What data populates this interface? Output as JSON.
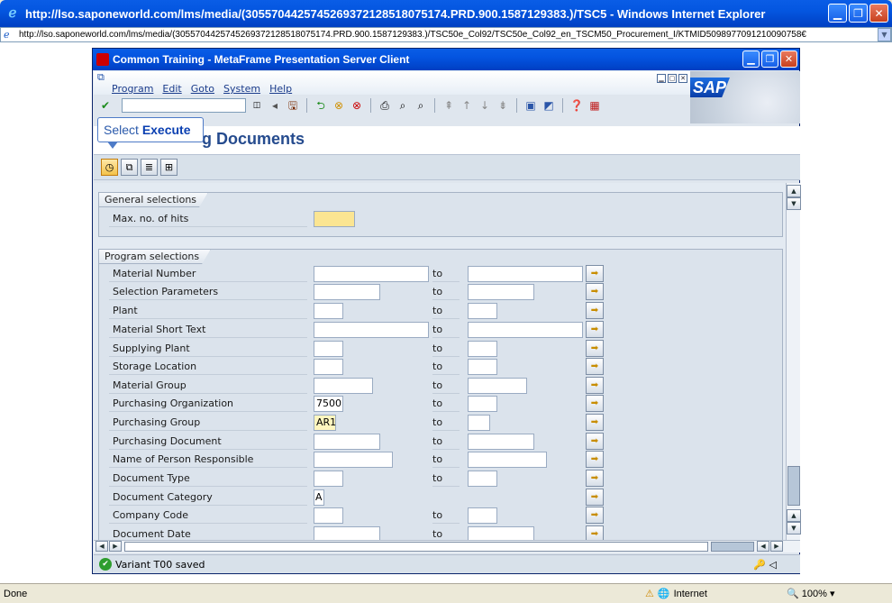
{
  "ie": {
    "title": "http://lso.saponeworld.com/lms/media/(3055704425745269372128518075174.PRD.900.1587129383.)/TSC5 - Windows Internet Explorer",
    "address": "http://lso.saponeworld.com/lms/media/(3055704425745269372128518075174.PRD.900.1587129383.)/TSC50e_Col92/TSC50e_Col92_en_TSCM50_Procurement_I/KTMID5098977091210090758€",
    "status_done": "Done",
    "zone_label": "Internet",
    "zoom": "100%"
  },
  "citrix": {
    "title": "Common Training - MetaFrame Presentation Server Client"
  },
  "sap": {
    "menu": [
      "Program",
      "Edit",
      "Goto",
      "System",
      "Help"
    ],
    "page_title": "g Documents",
    "tooltip_prefix": "Select ",
    "tooltip_bold": "Execute",
    "status_message": "Variant T00 saved",
    "groups": {
      "general": "General selections",
      "program": "Program selections"
    },
    "general_rows": [
      {
        "label": "Max. no. of hits",
        "value": ""
      }
    ],
    "program_rows": [
      {
        "label": "Material Number",
        "low": "",
        "to": "to",
        "high": ""
      },
      {
        "label": "Selection Parameters",
        "low": "",
        "to": "to",
        "high": ""
      },
      {
        "label": "Plant",
        "low": "",
        "to": "to",
        "high": ""
      },
      {
        "label": "Material Short Text",
        "low": "",
        "to": "to",
        "high": ""
      },
      {
        "label": "Supplying Plant",
        "low": "",
        "to": "to",
        "high": ""
      },
      {
        "label": "Storage Location",
        "low": "",
        "to": "to",
        "high": ""
      },
      {
        "label": "Material Group",
        "low": "",
        "to": "to",
        "high": ""
      },
      {
        "label": "Purchasing Organization",
        "low": "7500",
        "to": "to",
        "high": ""
      },
      {
        "label": "Purchasing Group",
        "low": "AR1",
        "to": "to",
        "high": ""
      },
      {
        "label": "Purchasing Document",
        "low": "",
        "to": "to",
        "high": ""
      },
      {
        "label": "Name of Person Responsible",
        "low": "",
        "to": "to",
        "high": ""
      },
      {
        "label": "Document Type",
        "low": "",
        "to": "to",
        "high": ""
      },
      {
        "label": "Document Category",
        "low": "A",
        "to": "",
        "high": ""
      },
      {
        "label": "Company Code",
        "low": "",
        "to": "to",
        "high": ""
      },
      {
        "label": "Document Date",
        "low": "",
        "to": "to",
        "high": ""
      }
    ]
  }
}
